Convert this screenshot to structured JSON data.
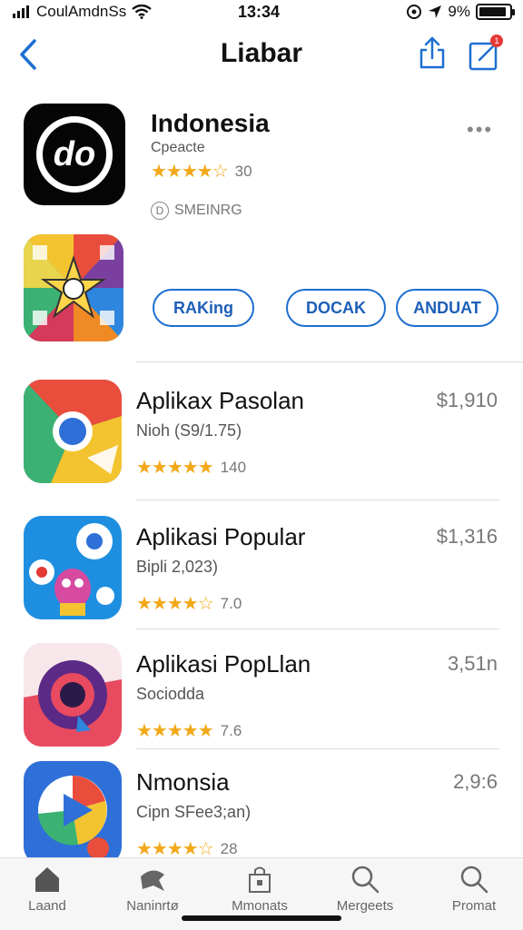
{
  "status_bar": {
    "carrier": "CoulAmdnSs",
    "time": "13:34",
    "battery_text": "9%",
    "battery_level": 0.9
  },
  "nav": {
    "title": "Liabar",
    "badge": "1"
  },
  "header_app": {
    "title": "Indonesia",
    "subtitle": "Cpeacte",
    "stars": "★★★★☆",
    "rating_count": "30",
    "tag_icon": "D",
    "tag": "SMEINRG",
    "more": "•••",
    "icon_letter": "do"
  },
  "pill_buttons": [
    {
      "label": "RAKing"
    },
    {
      "label": "DOCAK"
    },
    {
      "label": "ANDUAT"
    }
  ],
  "apps": [
    {
      "title": "Aplikax Pasolan",
      "subtitle": "Nioh (S9/1.75)",
      "stars": "★★★★★",
      "rating_count": "140",
      "price": "$1,910"
    },
    {
      "title": "Aplikasi Popular",
      "subtitle": "Bipli 2,023)",
      "stars": "★★★★☆",
      "rating_count": "7.0",
      "price": "$1,316"
    },
    {
      "title": "Aplikasi PopLlan",
      "subtitle": "Sociodda",
      "stars": "★★★★★",
      "rating_count": "7.6",
      "price": "3,51n"
    },
    {
      "title": "Nmonsia",
      "subtitle": "Cipn SFee3;an)",
      "stars": "★★★★☆",
      "rating_count": "28",
      "price": "2,9:6"
    }
  ],
  "tabs": [
    {
      "label": "Laand",
      "icon": "home-icon"
    },
    {
      "label": "Naninrtø",
      "icon": "games-icon"
    },
    {
      "label": "Mmonats",
      "icon": "apps-icon"
    },
    {
      "label": "Mergeets",
      "icon": "search-icon"
    },
    {
      "label": "Promat",
      "icon": "search-icon"
    }
  ]
}
